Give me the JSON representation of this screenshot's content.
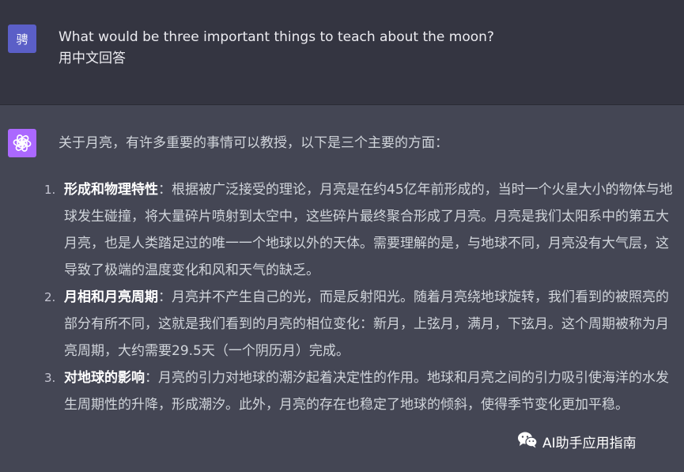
{
  "user_message": {
    "avatar_text": "骋",
    "line1": "What would be three important things to teach about the moon?",
    "line2": "用中文回答"
  },
  "assistant_message": {
    "intro": "关于月亮，有许多重要的事情可以教授，以下是三个主要的方面：",
    "items": [
      {
        "number": "1.",
        "title": "形成和物理特性",
        "text": "：根据被广泛接受的理论，月亮是在约45亿年前形成的，当时一个火星大小的物体与地球发生碰撞，将大量碎片喷射到太空中，这些碎片最终聚合形成了月亮。月亮是我们太阳系中的第五大月亮，也是人类踏足过的唯一一个地球以外的天体。需要理解的是，与地球不同，月亮没有大气层，这导致了极端的温度变化和风和天气的缺乏。"
      },
      {
        "number": "2.",
        "title": "月相和月亮周期",
        "text": "：月亮并不产生自己的光，而是反射阳光。随着月亮绕地球旋转，我们看到的被照亮的部分有所不同，这就是我们看到的月亮的相位变化：新月，上弦月，满月，下弦月。这个周期被称为月亮周期，大约需要29.5天（一个阴历月）完成。"
      },
      {
        "number": "3.",
        "title": "对地球的影响",
        "text": "：月亮的引力对地球的潮汐起着决定性的作用。地球和月亮之间的引力吸引使海洋的水发生周期性的升降，形成潮汐。此外，月亮的存在也稳定了地球的倾斜，使得季节变化更加平稳。"
      }
    ]
  },
  "watermark": {
    "text": "AI助手应用指南",
    "icon": "wechat-icon"
  },
  "colors": {
    "user_bg": "#343541",
    "assistant_bg": "#444654",
    "user_avatar": "#5b5fc7",
    "gpt_avatar": "#ab68ff"
  }
}
